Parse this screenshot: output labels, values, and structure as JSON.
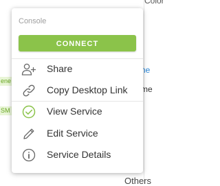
{
  "background": {
    "top_text": "Color",
    "blue_text": "ne",
    "dark_text": "me",
    "others_text": "Others",
    "badge_1": "ene",
    "badge_2": "SM"
  },
  "menu": {
    "section_title": "Console",
    "connect_label": "CONNECT",
    "items": [
      {
        "label": "Share",
        "icon": "add-user-icon"
      },
      {
        "label": "Copy Desktop Link",
        "icon": "link-icon"
      },
      {
        "label": "View Service",
        "icon": "check-circle-icon"
      },
      {
        "label": "Edit Service",
        "icon": "pencil-icon"
      },
      {
        "label": "Service Details",
        "icon": "info-icon"
      }
    ]
  },
  "colors": {
    "accent": "#8bc34a",
    "check_green": "#8bc34a",
    "icon_gray": "#666666",
    "link_blue": "#2a86d6"
  }
}
